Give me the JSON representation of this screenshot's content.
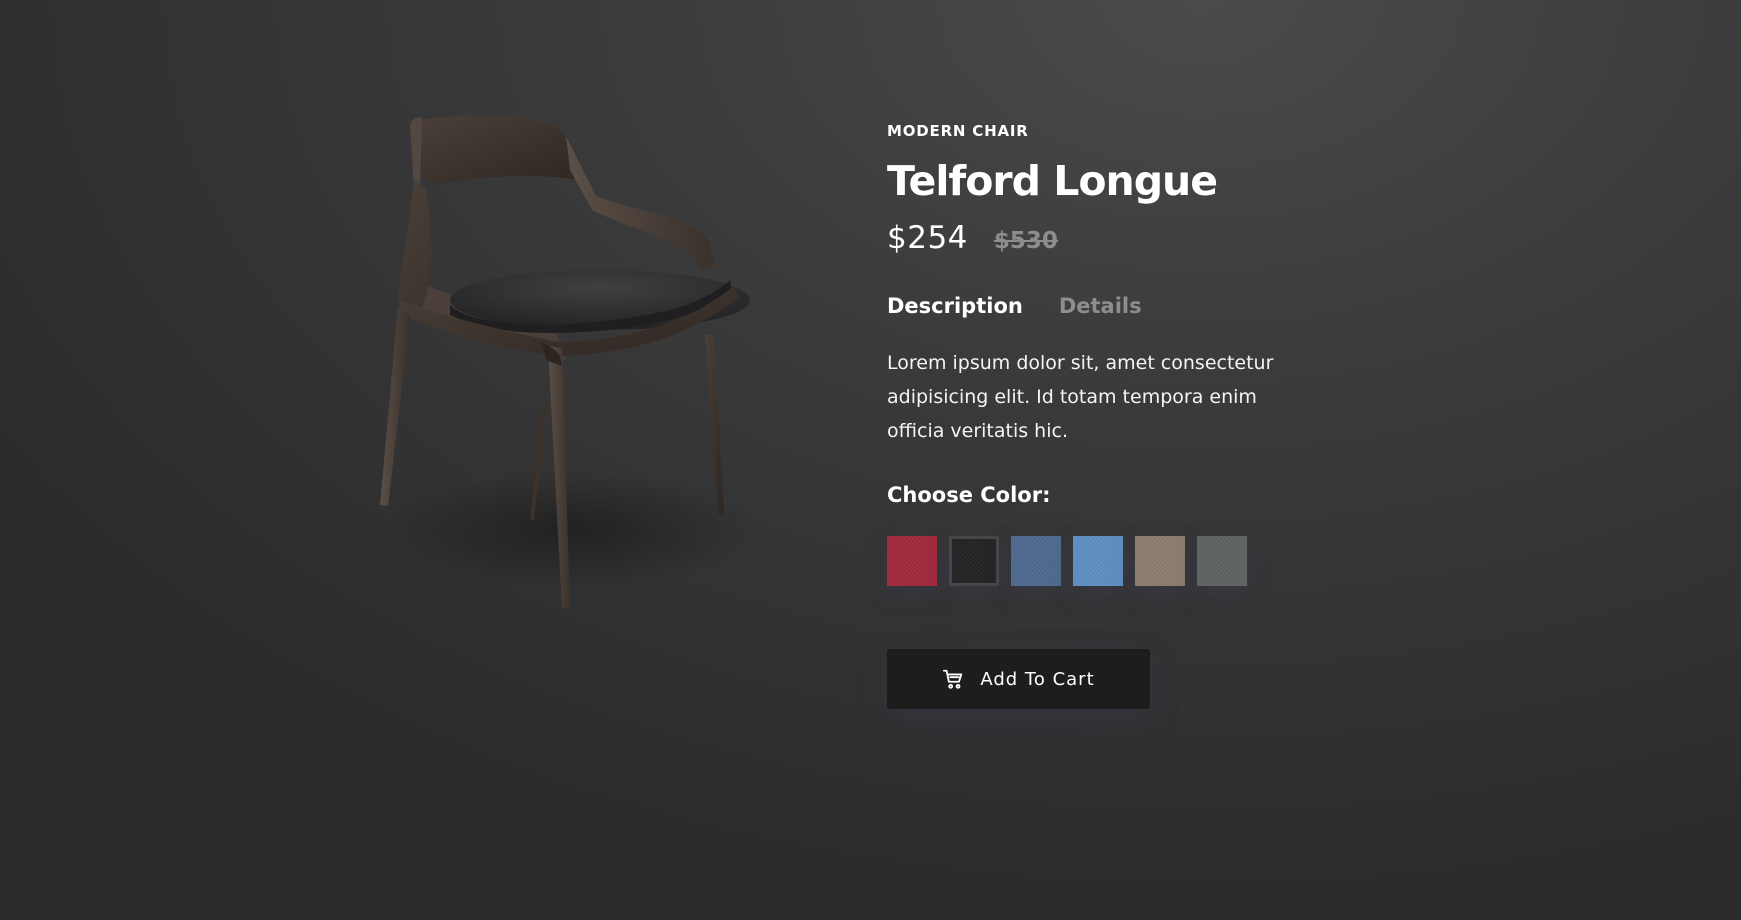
{
  "product": {
    "image_alt": "chair-product-image",
    "category": "MODERN CHAIR",
    "title": "Telford Longue",
    "price_current": "$254",
    "price_old": "$530"
  },
  "tabs": [
    {
      "label": "Description",
      "active": true
    },
    {
      "label": "Details",
      "active": false
    }
  ],
  "description": "Lorem ipsum dolor sit, amet consectetur adipisicing elit. Id totam tempora enim officia veritatis hic.",
  "color_picker": {
    "label": "Choose Color:",
    "selected_index": 1,
    "swatches": [
      {
        "name": "red",
        "color": "#a3293c"
      },
      {
        "name": "black",
        "color": "#232324"
      },
      {
        "name": "denim-blue",
        "color": "#4e6a8e"
      },
      {
        "name": "light-blue",
        "color": "#5e8fc2"
      },
      {
        "name": "beige",
        "color": "#8e7c6e"
      },
      {
        "name": "grey",
        "color": "#5f6463"
      }
    ]
  },
  "cart_button": {
    "label": "Add To Cart",
    "icon": "cart-icon"
  },
  "colors": {
    "background": "#3d3d3e",
    "button": "#1d1d1e",
    "muted_text": "#8e8e90"
  }
}
